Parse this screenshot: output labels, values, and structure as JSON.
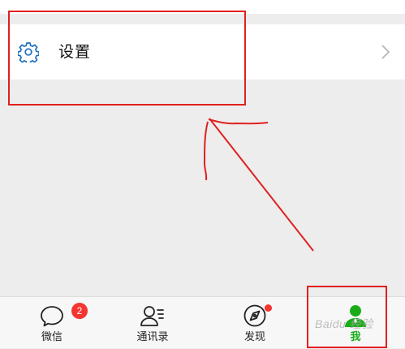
{
  "settings": {
    "icon": "gear-icon",
    "label": "设置",
    "chevron": "chevron-right-icon"
  },
  "tabbar": {
    "tabs": [
      {
        "id": "chats",
        "label": "微信",
        "icon": "chat-bubble-icon",
        "badge": "2",
        "active": false
      },
      {
        "id": "contacts",
        "label": "通讯录",
        "icon": "contacts-icon",
        "active": false
      },
      {
        "id": "discover",
        "label": "发现",
        "icon": "compass-icon",
        "dot": true,
        "active": false
      },
      {
        "id": "me",
        "label": "我",
        "icon": "person-icon",
        "active": true
      }
    ]
  },
  "watermark": "Baidu 经验",
  "colors": {
    "accent": "#1aad19",
    "badge": "#f43530",
    "annotation": "#e02020",
    "settings_icon": "#1e6fbf"
  }
}
